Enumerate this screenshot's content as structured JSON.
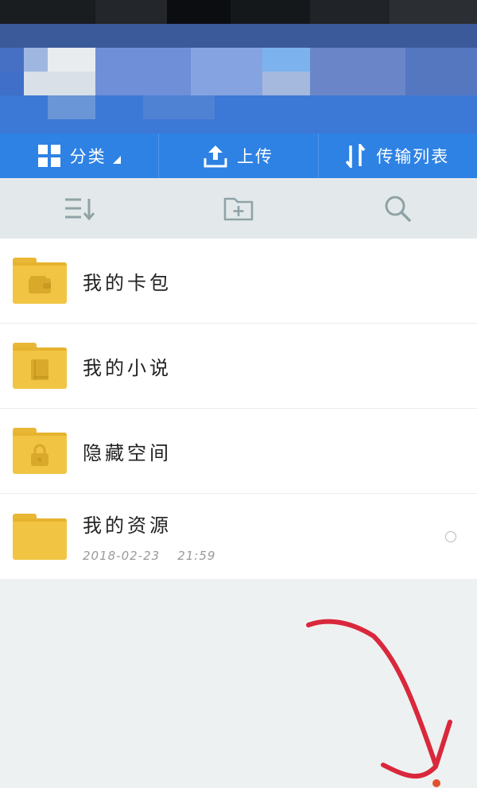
{
  "action_bar": {
    "category_label": "分类",
    "upload_label": "上传",
    "transfer_label": "传输列表"
  },
  "toolbar": {
    "sort_icon": "sort-icon",
    "new_folder_icon": "new-folder-icon",
    "search_icon": "search-icon"
  },
  "files": [
    {
      "name": "我的卡包",
      "icon": "wallet-icon"
    },
    {
      "name": "我的小说",
      "icon": "book-icon"
    },
    {
      "name": "隐藏空间",
      "icon": "lock-icon"
    },
    {
      "name": "我的资源",
      "date": "2018-02-23",
      "time": "21:59"
    }
  ],
  "colors": {
    "accent": "#2e82e4",
    "folder": "#f1c443",
    "annotation": "#d9283c"
  }
}
